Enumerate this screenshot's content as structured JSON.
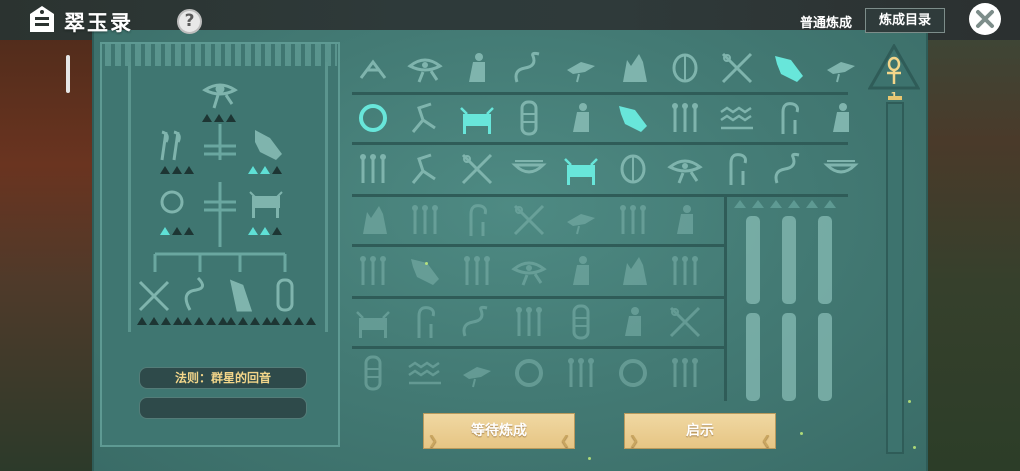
{
  "app": {
    "title": "翠玉录",
    "help_label": "?"
  },
  "header": {
    "mode_normal": "普通炼成",
    "mode_catalog": "炼成目录"
  },
  "stele": {
    "rule_label": "法则：群星的回音",
    "rule_second": ""
  },
  "actions": {
    "wait_label": "等待炼成",
    "hint_label": "启示"
  },
  "sidebar": {
    "level": "1"
  },
  "colors": {
    "tablet": "#437a74",
    "glyph_dim": "#7fb4ad",
    "glyph_lit": "#68e6da",
    "gold": "#f3d68a",
    "button": "#e6c584"
  },
  "glyph_grid": {
    "row1": [
      "scarab-bird",
      "eye-of-horus",
      "seated-figure",
      "serpent",
      "bird",
      "jackal",
      "scarab",
      "crossed-staffs",
      "anubis-lit",
      "bird"
    ],
    "row2": [
      "ring-lit",
      "heron",
      "bull-lit",
      "mummy",
      "seated-figure",
      "anubis-lit",
      "reeds",
      "waves",
      "crook",
      "seated-figure"
    ],
    "row3": [
      "reeds",
      "heron",
      "crossed-staffs",
      "basket",
      "bull-lit",
      "scarab",
      "eye-of-horus",
      "crook",
      "serpent",
      "basket"
    ]
  }
}
